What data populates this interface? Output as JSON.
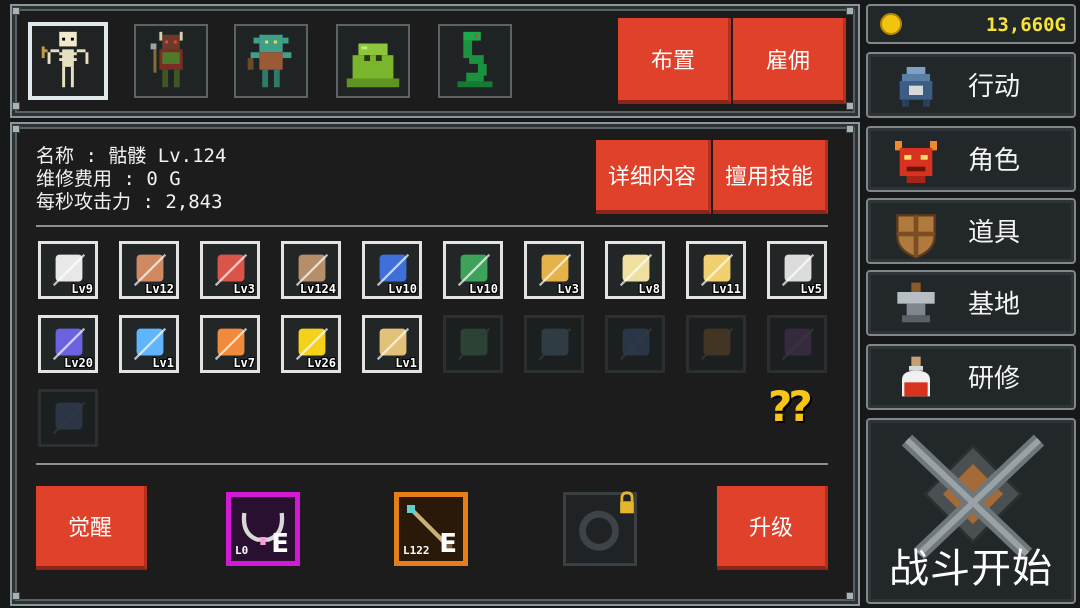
{
  "currency": {
    "amount": "13,660G"
  },
  "monster_tabs": [
    "skeleton",
    "orc-warrior",
    "goblin",
    "green-slime",
    "green-snake"
  ],
  "top_buttons": {
    "deploy": "布置",
    "hire": "雇佣"
  },
  "character": {
    "name_line": "名称 : 骷髅 Lv.124",
    "upkeep_line": "维修费用 : 0 G",
    "dps_line": "每秒攻击力 : 2,843"
  },
  "info_buttons": {
    "details": "详细内容",
    "skills": "擅用技能"
  },
  "skills": [
    {
      "icon": "shield-icon",
      "level": "Lv9",
      "color": "#e8e8e8"
    },
    {
      "icon": "skull-icon",
      "level": "Lv12",
      "color": "#d08a62"
    },
    {
      "icon": "meat-icon",
      "level": "Lv3",
      "color": "#d9554a"
    },
    {
      "icon": "bow-icon",
      "level": "Lv124",
      "color": "#b58f6a"
    },
    {
      "icon": "blue-arrows-icon",
      "level": "Lv10",
      "color": "#3f6fd8"
    },
    {
      "icon": "green-arrows-icon",
      "level": "Lv10",
      "color": "#3da35a"
    },
    {
      "icon": "goblet-icon",
      "level": "Lv3",
      "color": "#e6b34a"
    },
    {
      "icon": "horseshoe-icon",
      "level": "Lv8",
      "color": "#efe0a0"
    },
    {
      "icon": "crossbow-bolts-icon",
      "level": "Lv11",
      "color": "#f0d070"
    },
    {
      "icon": "shield-heart-icon",
      "level": "Lv5",
      "color": "#dcdcdc"
    },
    {
      "icon": "purple-orb-icon",
      "level": "Lv20",
      "color": "#6b62e0"
    },
    {
      "icon": "lightning-bow-icon",
      "level": "Lv1",
      "color": "#5fb6ff"
    },
    {
      "icon": "fire-arrow-icon",
      "level": "Lv7",
      "color": "#f08a3c"
    },
    {
      "icon": "yellow-up-arrow-icon",
      "level": "Lv26",
      "color": "#f4d21c"
    },
    {
      "icon": "ring-icon",
      "level": "Lv1",
      "color": "#e2c27a"
    },
    {
      "icon": "locked-green-arrows-icon",
      "level": "",
      "color": "#2d4a36"
    },
    {
      "icon": "locked-crossbow-icon",
      "level": "",
      "color": "#34424a"
    },
    {
      "icon": "locked-blue-arrows-icon",
      "level": "",
      "color": "#2c3b4f"
    },
    {
      "icon": "locked-club-icon",
      "level": "",
      "color": "#4a3a22"
    },
    {
      "icon": "locked-purple-bow-icon",
      "level": "",
      "color": "#3b2d45"
    },
    {
      "icon": "locked-blue-bow-icon",
      "level": "",
      "color": "#2e3a4d"
    }
  ],
  "mystery_mark": "??",
  "bottom": {
    "awaken_label": "觉醒",
    "upgrade_label": "升级",
    "necklace": {
      "level": "L0",
      "tag": "E",
      "color": "#d21ad6"
    },
    "arrow_item": {
      "level": "L122",
      "tag": "E",
      "color": "#e57f1a"
    },
    "ring_slot": {
      "locked": true
    }
  },
  "sidebar": {
    "items": [
      {
        "label": "行动",
        "icon": "cauldron-icon"
      },
      {
        "label": "角色",
        "icon": "demon-mask-icon"
      },
      {
        "label": "道具",
        "icon": "wooden-shield-icon"
      },
      {
        "label": "基地",
        "icon": "anvil-icon"
      },
      {
        "label": "研修",
        "icon": "potion-icon"
      }
    ],
    "battle_label": "战斗开始"
  },
  "colors": {
    "accent_red": "#e0412a",
    "gold": "#f1c40f",
    "panel_bg": "#1c1c1c",
    "frame": "#8d969a"
  }
}
